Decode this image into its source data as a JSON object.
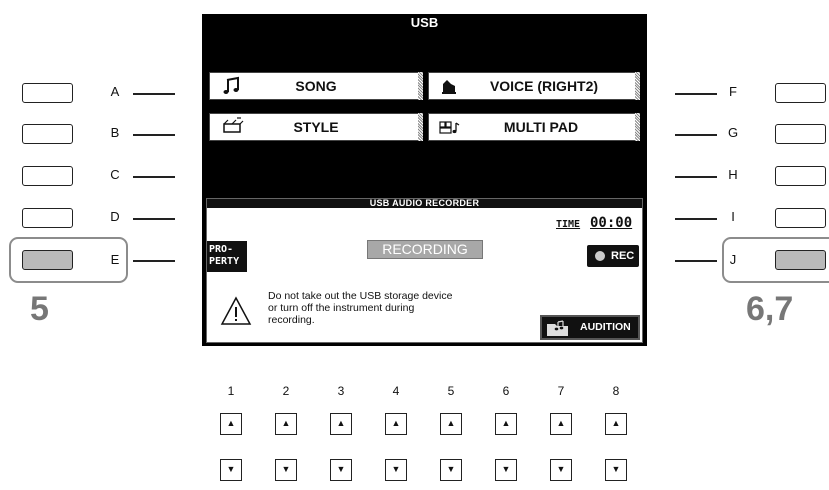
{
  "screen": {
    "title": "USB",
    "menu_left": [
      {
        "label": "SONG",
        "icon": "music-note-icon"
      },
      {
        "label": "STYLE",
        "icon": "style-icon"
      }
    ],
    "menu_right": [
      {
        "label": "VOICE (RIGHT2)",
        "icon": "voice-icon"
      },
      {
        "label": "MULTI PAD",
        "icon": "multipad-icon"
      }
    ],
    "recorder": {
      "header": "USB AUDIO RECORDER",
      "time_label": "TIME",
      "time_value": "00:00",
      "status": "RECORDING",
      "property_line1": "PRO-",
      "property_line2": "PERTY",
      "rec_label": "REC",
      "warning_line1": "Do not take out the USB storage device",
      "warning_line2": "or turn off the instrument during",
      "warning_line3": "recording.",
      "audition_label": "AUDITION"
    }
  },
  "left_buttons": [
    "A",
    "B",
    "C",
    "D",
    "E"
  ],
  "right_buttons": [
    "F",
    "G",
    "H",
    "I",
    "J"
  ],
  "step_left": "5",
  "step_right": "6,7",
  "number_buttons": [
    "1",
    "2",
    "3",
    "4",
    "5",
    "6",
    "7",
    "8"
  ],
  "colors": {
    "lcd_bg": "#000000",
    "pressed_button": "#b9b9b9",
    "highlight": "#8c8c8c"
  }
}
